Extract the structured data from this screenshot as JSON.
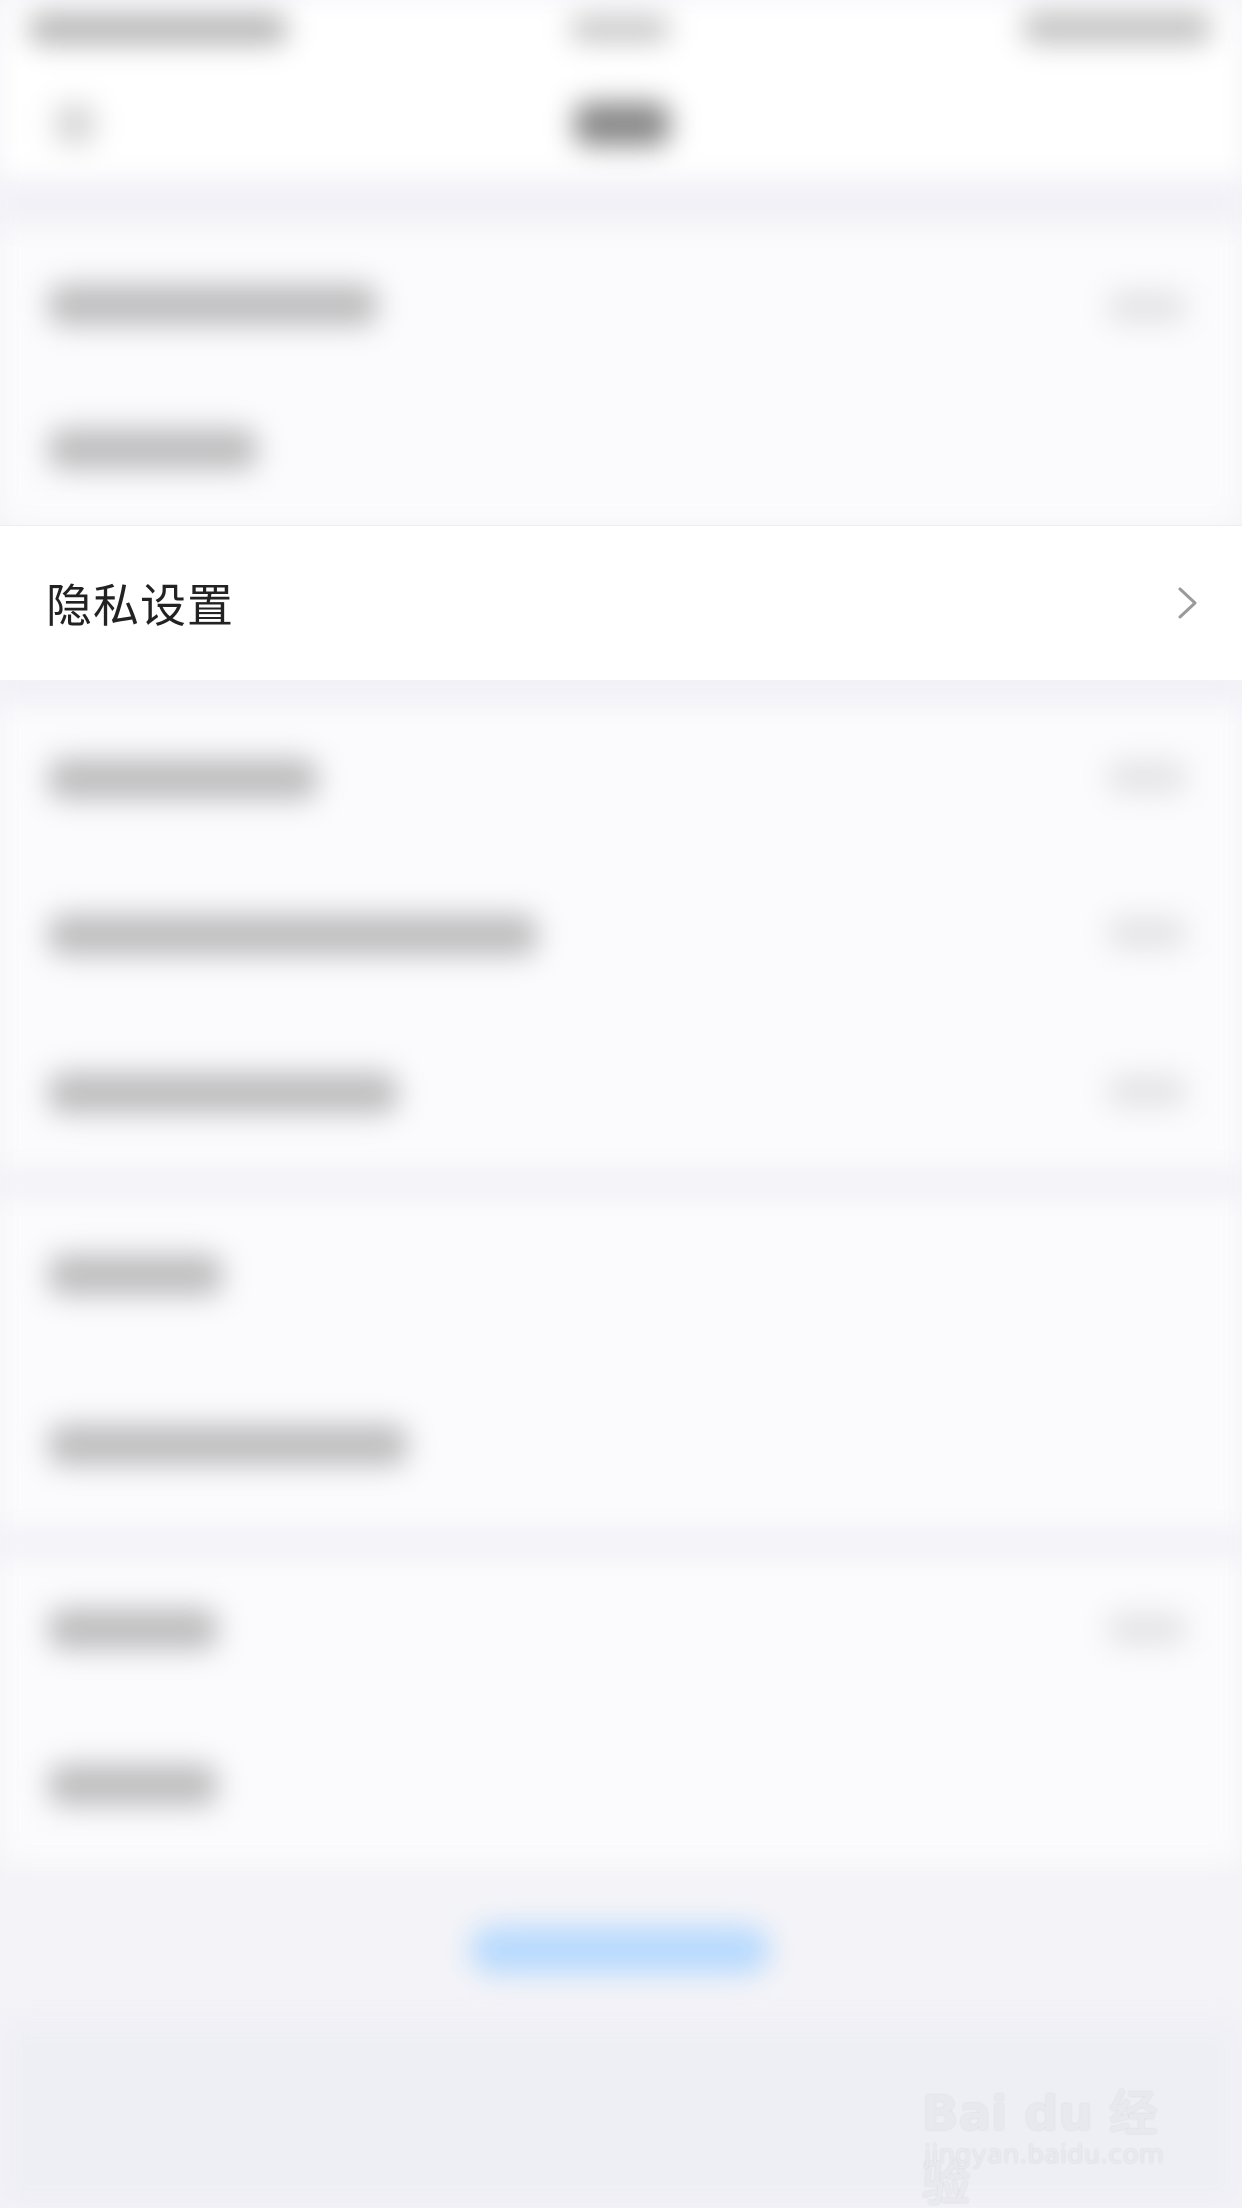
{
  "privacy_row": {
    "label": "隐私设置",
    "chevron_icon": "chevron-right-icon"
  },
  "watermark": {
    "logo": "Bai du 经验",
    "url": "jingyan.baidu.com"
  },
  "colors": {
    "background": "#f4f4f8",
    "row_background": "#ffffff",
    "text": "#222222",
    "link_blur": "#a9d3ff"
  }
}
